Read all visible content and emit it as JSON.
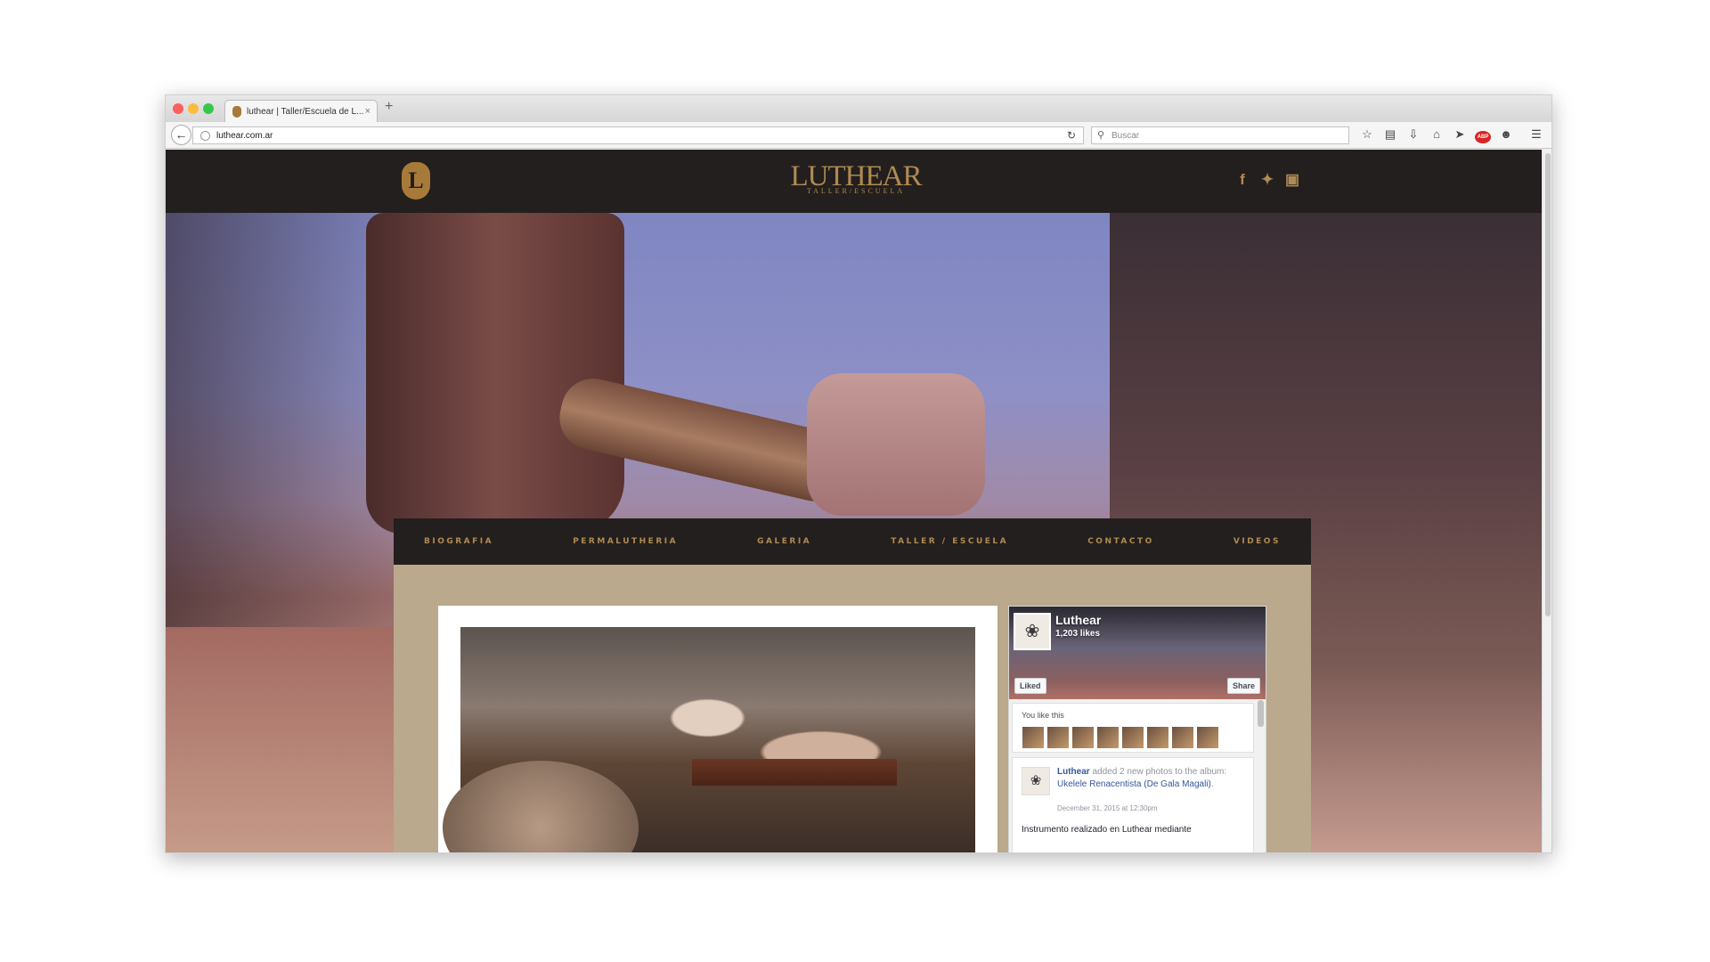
{
  "browser": {
    "tab_title": "luthear | Taller/Escuela de L...",
    "tab_close": "×",
    "new_tab": "+",
    "url": "luthear.com.ar",
    "search_placeholder": "Buscar"
  },
  "site": {
    "logo_letter": "L",
    "brand_name": "LUTHEAR",
    "brand_subtitle": "TALLER/ESCUELA",
    "social": [
      "facebook-icon",
      "twitter-icon",
      "instagram-icon"
    ],
    "menu": [
      "BIOGRAFIA",
      "PERMALUTHERIA",
      "GALERIA",
      "TALLER / ESCUELA",
      "CONTACTO",
      "VIDEOS"
    ]
  },
  "fb": {
    "page_name": "Luthear",
    "likes": "1,203 likes",
    "liked_label": "Liked",
    "share_label": "Share",
    "you_like": "You like this",
    "post": {
      "author": "Luthear",
      "action": " added 2 new photos to the album: ",
      "album": "Ukelele Renacentista (De Gala Magali)",
      "end": ".",
      "date": "December 31, 2015 at 12:30pm",
      "body": "Instrumento realizado en Luthear mediante"
    }
  },
  "colors": {
    "header_bg": "#231f1e",
    "gold": "#b08a52",
    "content_bg": "#baa98c",
    "fb_link": "#365899"
  }
}
